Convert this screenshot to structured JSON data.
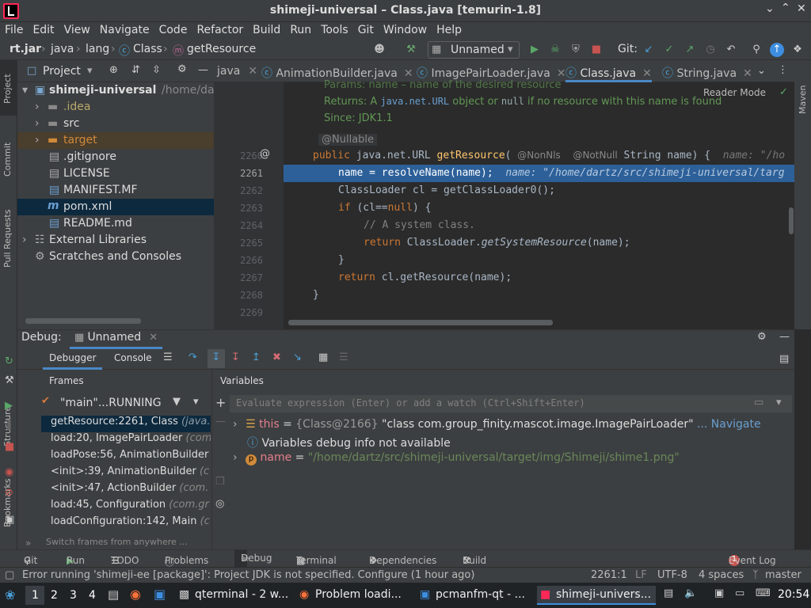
{
  "window": {
    "title": "shimeji-universal – Class.java [temurin-1.8]"
  },
  "menu": [
    "File",
    "Edit",
    "View",
    "Navigate",
    "Code",
    "Refactor",
    "Build",
    "Run",
    "Tools",
    "Git",
    "Window",
    "Help"
  ],
  "breadcrumbs": [
    "rt.jar",
    "java",
    "lang",
    "Class",
    "getResource"
  ],
  "run_config": "Unnamed",
  "git_label": "Git:",
  "project_panel": {
    "title": "Project",
    "root_name": "shimeji-universal",
    "root_path": "/home/dartz",
    "items": [
      ".idea",
      "src",
      "target",
      ".gitignore",
      "LICENSE",
      "MANIFEST.MF",
      "pom.xml",
      "README.md",
      "External Libraries",
      "Scratches and Consoles"
    ]
  },
  "left_strip": {
    "project": "Project",
    "commit": "Commit",
    "pull": "Pull Requests",
    "structure": "Structure",
    "bookmarks": "Bookmarks"
  },
  "right_strip": {
    "maven": "Maven"
  },
  "tabs": [
    "java",
    "AnimationBuilder.java",
    "ImagePairLoader.java",
    "Class.java",
    "String.java"
  ],
  "editor": {
    "reader_mode": "Reader Mode",
    "doc": {
      "params": "Params:  name – name of the desired resource",
      "returns_prefix": "Returns:  A ",
      "returns_code": "java.net.URL",
      "returns_mid": " object or ",
      "returns_null": "null",
      "returns_suffix": " if no resource with this name is found",
      "since": "Since:      JDK1.1"
    },
    "nullable": "@Nullable",
    "line_numbers": [
      "2260",
      "2261",
      "2262",
      "2263",
      "2264",
      "2265",
      "2266",
      "2267",
      "2268",
      "2269"
    ],
    "lines": {
      "l2260_kw": "public ",
      "l2260_type": "java.net.URL ",
      "l2260_fn": "getResource",
      "l2260_paren": "( ",
      "l2260_ann1": "@NonNls",
      "l2260_ann2": "@NotNull",
      "l2260_rest": " String name) {",
      "l2260_hint": "name: \"/ho",
      "l2261_code": "name = resolveName(name);",
      "l2261_hint": "name: \"/home/dartz/src/shimeji-universal/targ",
      "l2262": "ClassLoader cl = getClassLoader0();",
      "l2263_kw": "if ",
      "l2263_open": "(cl==",
      "l2263_null": "null",
      "l2263_close": ") {",
      "l2264": "// A system class.",
      "l2265_kw": "return ",
      "l2265_a": "ClassLoader.",
      "l2265_b": "getSystemResource",
      "l2265_c": "(name);",
      "l2266": "}",
      "l2267_kw": "return ",
      "l2267_rest": "cl.getResource(name);",
      "l2268": "}"
    }
  },
  "debug": {
    "label": "Debug:",
    "config": "Unnamed",
    "tabs": [
      "Debugger",
      "Console"
    ],
    "frames_title": "Frames",
    "thread": "\"main\"...RUNNING",
    "frames": [
      {
        "m": "getResource:2261, Class",
        "c": "(java.l"
      },
      {
        "m": "load:20, ImagePairLoader",
        "c": "(com."
      },
      {
        "m": "loadPose:56, AnimationBuilder",
        "c": ""
      },
      {
        "m": "<init>:39, AnimationBuilder",
        "c": "(c"
      },
      {
        "m": "<init>:47, ActionBuilder",
        "c": "(com."
      },
      {
        "m": "load:45, Configuration",
        "c": "(com.gr"
      },
      {
        "m": "loadConfiguration:142, Main",
        "c": "(c"
      }
    ],
    "switch_hint": "Switch frames from anywhere ...",
    "variables_title": "Variables",
    "eval_placeholder": "Evaluate expression (Enter) or add a watch (Ctrl+Shift+Enter)",
    "vars": {
      "this_name": "this",
      "this_eq": " = ",
      "this_obj": "{Class@2166} ",
      "this_val": "\"class com.group_finity.mascot.image.ImagePairLoader\"",
      "this_nav": "... Navigate",
      "info": "Variables debug info not available",
      "name_name": "name",
      "name_val": "\"/home/dartz/src/shimeji-universal/target/img/Shimeji/shime1.png\""
    }
  },
  "bottom_tabs": [
    "Git",
    "Run",
    "TODO",
    "Problems",
    "Debug",
    "Terminal",
    "Dependencies",
    "Build"
  ],
  "event_log": "Event Log",
  "event_count": "1",
  "status": {
    "message": "Error running 'shimeji-ee [package]': Project JDK is not specified. Configure (1 hour ago)",
    "position": "2261:1",
    "lf": "LF",
    "encoding": "UTF-8",
    "indent": "4 spaces",
    "branch": "master"
  },
  "taskbar": {
    "workspaces": [
      "1",
      "2",
      "3",
      "4"
    ],
    "tasks": [
      "qterminal - 2 w...",
      "Problem loadi...",
      "pcmanfm-qt - ...",
      "shimeji-univers..."
    ],
    "clock": "20:54"
  }
}
